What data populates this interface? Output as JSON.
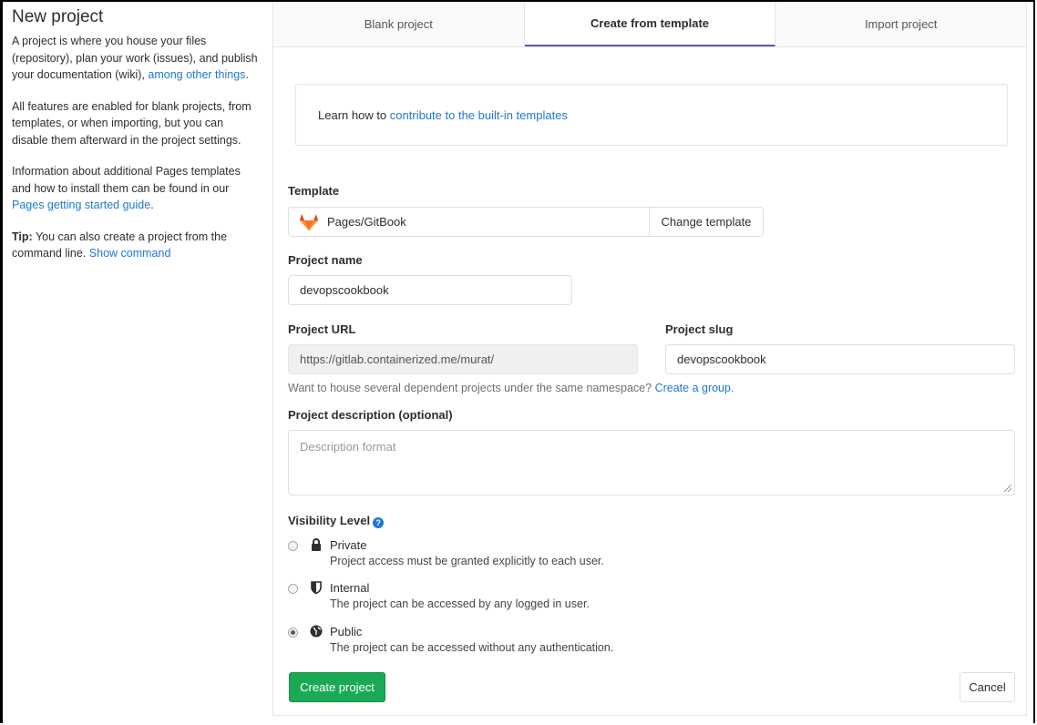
{
  "sidebar": {
    "title": "New project",
    "p1_text": "A project is where you house your files (repository), plan your work (issues), and publish your documentation (wiki),",
    "p1_link": "among other things",
    "p1_end": ".",
    "p2_text": "All features are enabled for blank projects, from templates, or when importing, but you can disable them afterward in the project settings.",
    "p3_text": "Information about additional Pages templates and how to install them can be found in our",
    "p3_link": "Pages getting started guide",
    "p3_end": ".",
    "tip_label": "Tip:",
    "tip_text": "You can also create a project from the command line.",
    "tip_link": "Show command"
  },
  "tabs": [
    {
      "label": "Blank project",
      "active": false
    },
    {
      "label": "Create from template",
      "active": true
    },
    {
      "label": "Import project",
      "active": false
    }
  ],
  "notice": {
    "text": "Learn how to",
    "link": "contribute to the built-in templates"
  },
  "template": {
    "label": "Template",
    "selected": "Pages/GitBook",
    "icon": "gitlab-tanuki-icon",
    "change_label": "Change template"
  },
  "project_name": {
    "label": "Project name",
    "value": "devopscookbook"
  },
  "project_url": {
    "label": "Project URL",
    "value": "https://gitlab.containerized.me/murat/"
  },
  "project_slug": {
    "label": "Project slug",
    "value": "devopscookbook"
  },
  "group_help": {
    "text": "Want to house several dependent projects under the same namespace?",
    "link": "Create a group."
  },
  "description": {
    "label": "Project description (optional)",
    "placeholder": "Description format"
  },
  "visibility": {
    "label": "Visibility Level",
    "help_icon": "question-circle-icon",
    "options": [
      {
        "title": "Private",
        "desc": "Project access must be granted explicitly to each user.",
        "icon": "lock-icon",
        "checked": false
      },
      {
        "title": "Internal",
        "desc": "The project can be accessed by any logged in user.",
        "icon": "shield-icon",
        "checked": false
      },
      {
        "title": "Public",
        "desc": "The project can be accessed without any authentication.",
        "icon": "globe-icon",
        "checked": true
      }
    ]
  },
  "actions": {
    "create_label": "Create project",
    "cancel_label": "Cancel"
  },
  "colors": {
    "primary_green": "#1aaa55",
    "link_blue": "#1f78d1",
    "active_tab_underline": "#6b4fbb"
  }
}
